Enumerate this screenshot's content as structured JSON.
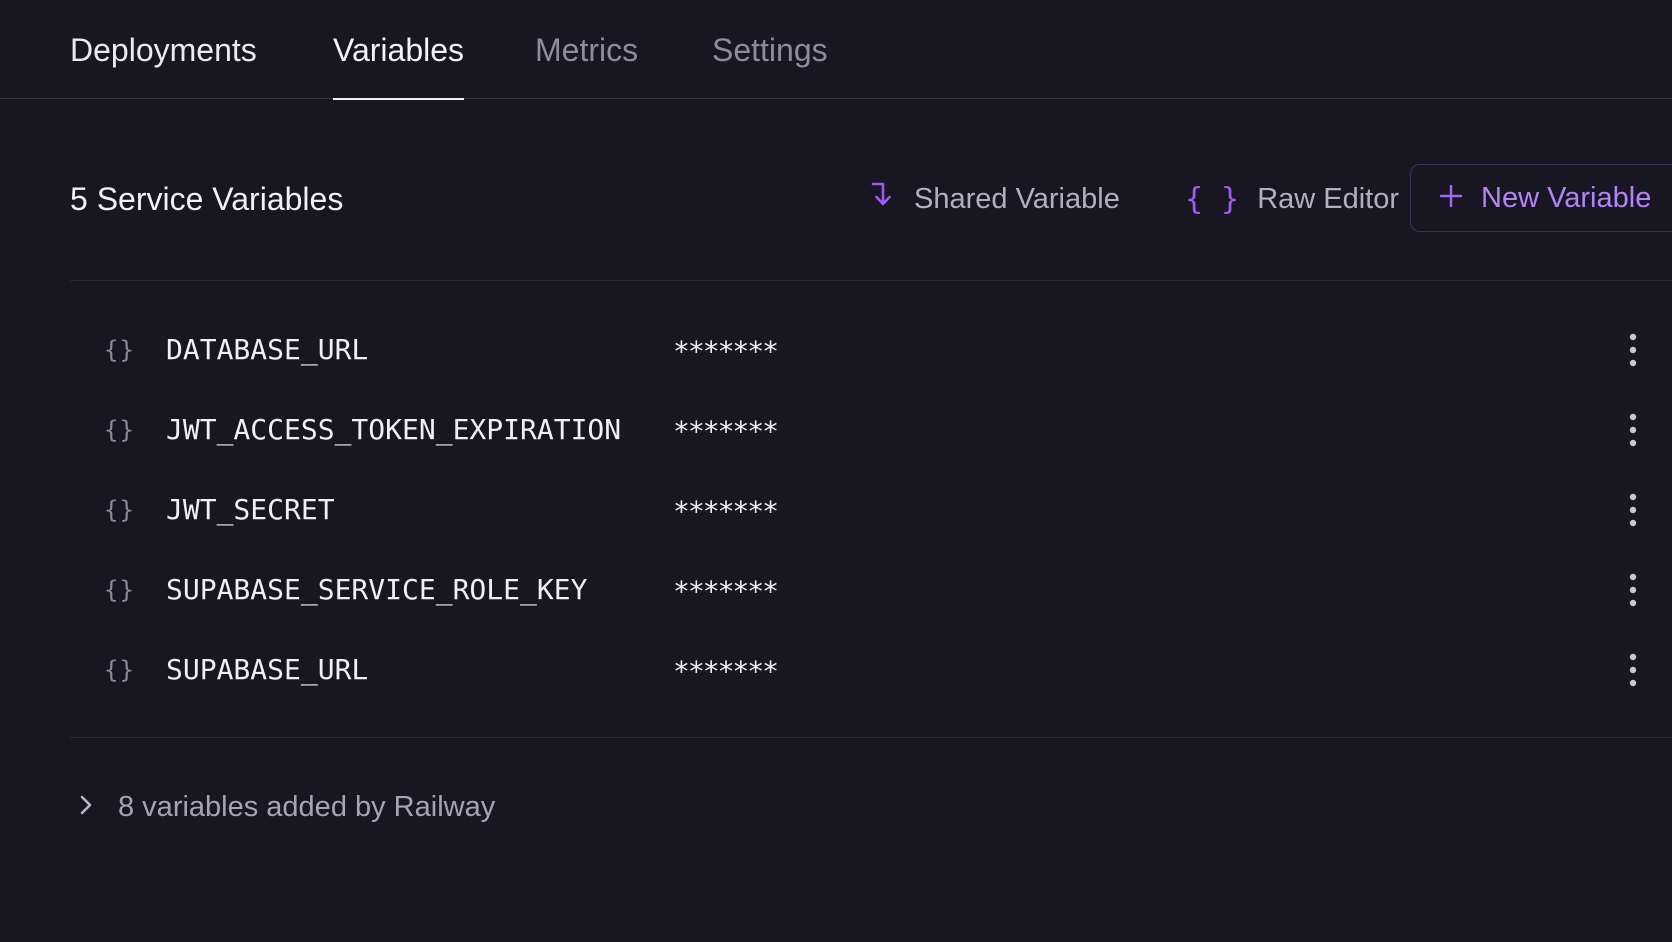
{
  "tabs": [
    {
      "label": "Deployments",
      "active": false
    },
    {
      "label": "Variables",
      "active": true
    },
    {
      "label": "Metrics",
      "active": false
    },
    {
      "label": "Settings",
      "active": false
    }
  ],
  "section": {
    "title": "5 Service Variables",
    "shared_variable_label": "Shared Variable",
    "raw_editor_label": "Raw Editor",
    "new_variable_label": "New Variable",
    "raw_editor_icon_text": "{ }"
  },
  "variables": [
    {
      "icon_text": "{}",
      "name": "DATABASE_URL",
      "value": "*******"
    },
    {
      "icon_text": "{}",
      "name": "JWT_ACCESS_TOKEN_EXPIRATION",
      "value": "*******"
    },
    {
      "icon_text": "{}",
      "name": "JWT_SECRET",
      "value": "*******"
    },
    {
      "icon_text": "{}",
      "name": "SUPABASE_SERVICE_ROLE_KEY",
      "value": "*******"
    },
    {
      "icon_text": "{}",
      "name": "SUPABASE_URL",
      "value": "*******"
    }
  ],
  "railway": {
    "label": "8 variables added by Railway"
  },
  "colors": {
    "background": "#181622",
    "accent": "#9b5cf0",
    "text": "#f0eef6",
    "muted": "#8f8b9f"
  }
}
